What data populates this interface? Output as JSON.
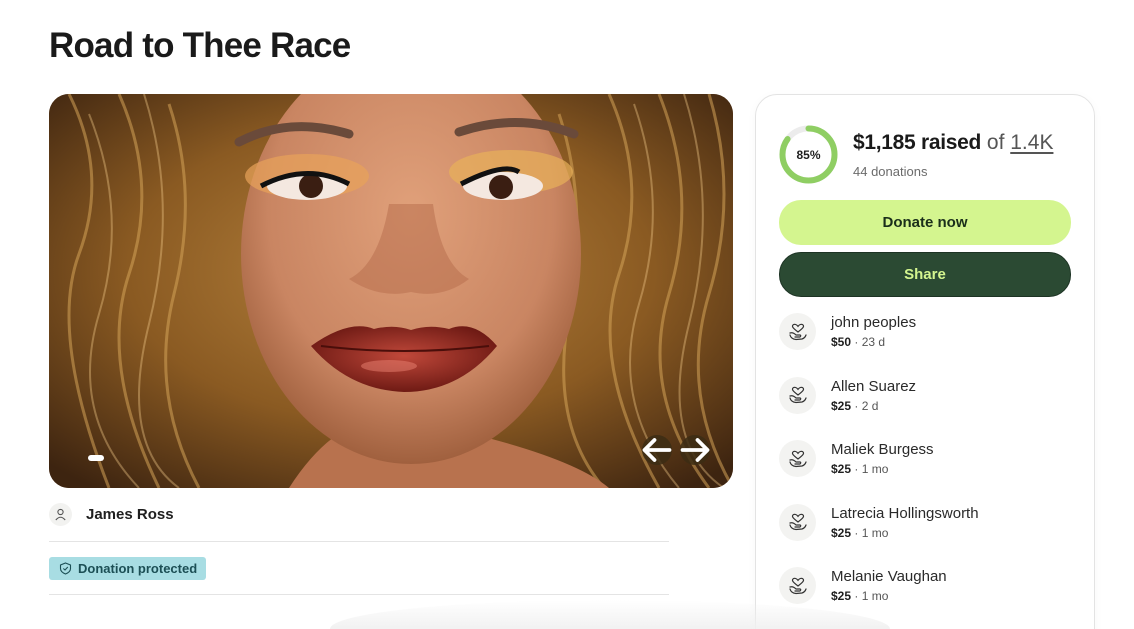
{
  "campaign": {
    "title": "Road to Thee Race",
    "organizer": "James Ross",
    "badge": "Donation protected"
  },
  "hero": {
    "image_subject": "portrait photo of a person with curly blonde-brown hair and red lipstick",
    "slide_index": 1,
    "prev_icon": "arrow-left-icon",
    "next_icon": "arrow-right-icon"
  },
  "progress": {
    "percent_label": "85%",
    "percent": 85,
    "raised": "$1,185 raised",
    "of": "of",
    "goal": "1.4K",
    "donations": "44 donations"
  },
  "actions": {
    "donate": "Donate now",
    "share": "Share"
  },
  "donors": [
    {
      "name": "john peoples",
      "amount": "$50",
      "time": " · 23 d"
    },
    {
      "name": "Allen Suarez",
      "amount": "$25",
      "time": " · 2 d"
    },
    {
      "name": "Maliek Burgess",
      "amount": "$25",
      "time": " · 1 mo"
    },
    {
      "name": "Latrecia Hollingsworth",
      "amount": "$25",
      "time": " · 1 mo"
    },
    {
      "name": "Melanie Vaughan",
      "amount": "$25",
      "time": " · 1 mo"
    }
  ],
  "colors": {
    "accent_green": "#d4f58f",
    "dark_green": "#2b4a33",
    "progress_green": "#8fce63",
    "badge_bg": "#a8dde3"
  }
}
